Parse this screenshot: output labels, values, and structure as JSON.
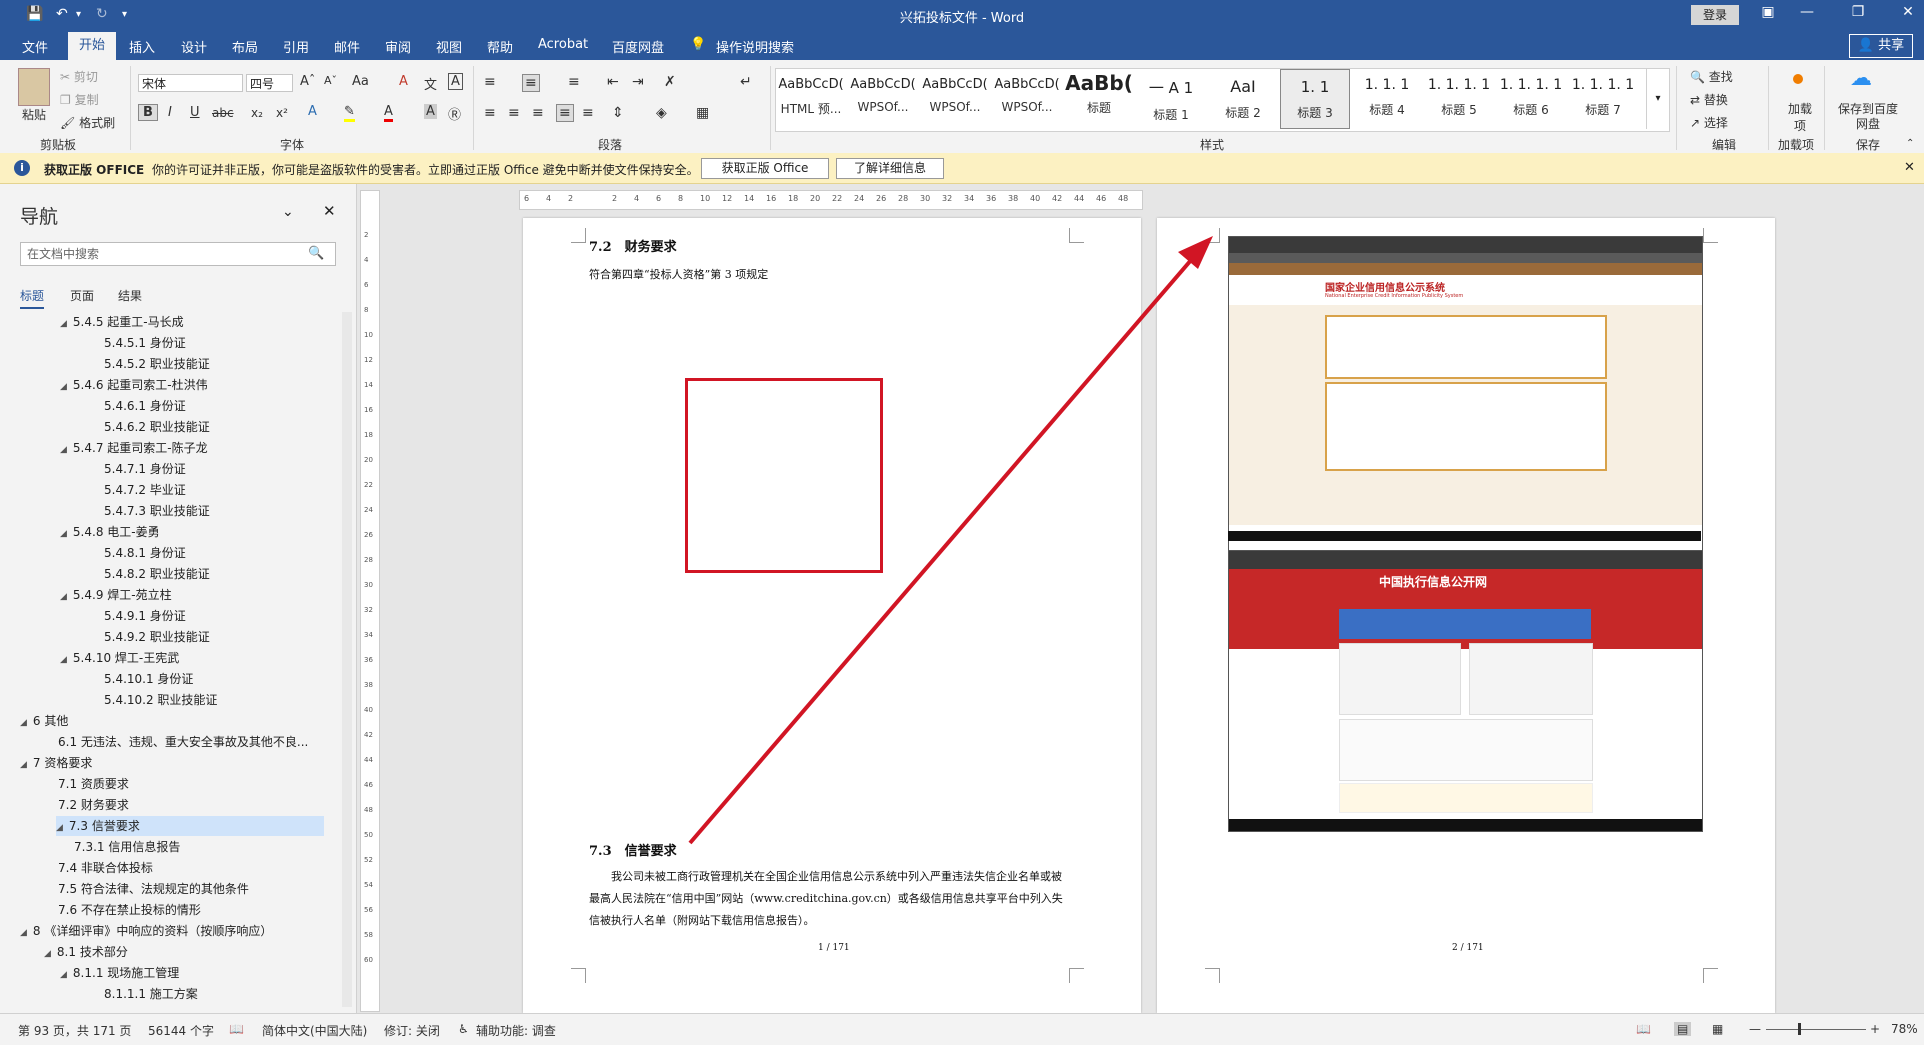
{
  "window": {
    "title": "兴拓投标文件 - Word",
    "login": "登录",
    "share": "共享"
  },
  "tabs": [
    "文件",
    "开始",
    "插入",
    "设计",
    "布局",
    "引用",
    "邮件",
    "审阅",
    "视图",
    "帮助",
    "Acrobat",
    "百度网盘",
    "操作说明搜索"
  ],
  "ribbon": {
    "clipboard": {
      "paste": "粘贴",
      "cut": "剪切",
      "copy": "复制",
      "format_painter": "格式刷",
      "label": "剪贴板"
    },
    "font": {
      "name": "宋体",
      "size": "四号",
      "label": "字体"
    },
    "paragraph": {
      "label": "段落"
    },
    "styles": {
      "label": "样式",
      "items": [
        {
          "preview": "AaBbCcD(",
          "name": "HTML 预..."
        },
        {
          "preview": "AaBbCcD(",
          "name": "WPSOf..."
        },
        {
          "preview": "AaBbCcD(",
          "name": "WPSOf..."
        },
        {
          "preview": "AaBbCcD(",
          "name": "WPSOf..."
        },
        {
          "preview": "AaBb(",
          "name": "标题"
        },
        {
          "preview": "一  A  1",
          "name": "标题 1"
        },
        {
          "preview": "AaI",
          "name": "标题 2"
        },
        {
          "preview": "1. 1",
          "name": "标题 3"
        },
        {
          "preview": "1. 1. 1",
          "name": "标题 4"
        },
        {
          "preview": "1. 1. 1. 1",
          "name": "标题 5"
        },
        {
          "preview": "1. 1. 1. 1",
          "name": "标题 6"
        },
        {
          "preview": "1. 1. 1. 1",
          "name": "标题 7"
        }
      ]
    },
    "editing": {
      "find": "查找",
      "replace": "替换",
      "select": "选择",
      "label": "编辑"
    },
    "addins": {
      "name": "加载项",
      "label": "加载项"
    },
    "save": {
      "name": "保存到百度网盘",
      "label": "保存"
    }
  },
  "infobar": {
    "title": "获取正版 OFFICE",
    "message": "你的许可证并非正版，你可能是盗版软件的受害者。立即通过正版 Office 避免中断并使文件保持安全。",
    "btn_get": "获取正版 Office",
    "btn_more": "了解详细信息"
  },
  "nav": {
    "title": "导航",
    "search_placeholder": "在文档中搜索",
    "tabs": [
      "标题",
      "页面",
      "结果"
    ],
    "tree": [
      {
        "text": "5.4.5 起重工-马长成",
        "level": 3,
        "exp": true
      },
      {
        "text": "5.4.5.1 身份证",
        "level": 4
      },
      {
        "text": "5.4.5.2 职业技能证",
        "level": 4
      },
      {
        "text": "5.4.6 起重司索工-杜洪伟",
        "level": 3,
        "exp": true
      },
      {
        "text": "5.4.6.1 身份证",
        "level": 4
      },
      {
        "text": "5.4.6.2 职业技能证",
        "level": 4
      },
      {
        "text": "5.4.7 起重司索工-陈子龙",
        "level": 3,
        "exp": true
      },
      {
        "text": "5.4.7.1 身份证",
        "level": 4
      },
      {
        "text": "5.4.7.2 毕业证",
        "level": 4
      },
      {
        "text": "5.4.7.3 职业技能证",
        "level": 4
      },
      {
        "text": "5.4.8 电工-姜勇",
        "level": 3,
        "exp": true
      },
      {
        "text": "5.4.8.1 身份证",
        "level": 4
      },
      {
        "text": "5.4.8.2 职业技能证",
        "level": 4
      },
      {
        "text": "5.4.9 焊工-苑立柱",
        "level": 3,
        "exp": true
      },
      {
        "text": "5.4.9.1 身份证",
        "level": 4
      },
      {
        "text": "5.4.9.2 职业技能证",
        "level": 4
      },
      {
        "text": "5.4.10 焊工-王宪武",
        "level": 3,
        "exp": true
      },
      {
        "text": "5.4.10.1 身份证",
        "level": 4
      },
      {
        "text": "5.4.10.2 职业技能证",
        "level": 4
      },
      {
        "text": "6 其他",
        "level": 1,
        "exp": true
      },
      {
        "text": "6.1 无违法、违规、重大安全事故及其他不良...",
        "level": 2
      },
      {
        "text": "7 资格要求",
        "level": 1,
        "exp": true
      },
      {
        "text": "7.1 资质要求",
        "level": 2
      },
      {
        "text": "7.2 财务要求",
        "level": 2
      },
      {
        "text": "7.3 信誉要求",
        "level": 2,
        "exp": true,
        "sel": true
      },
      {
        "text": "7.3.1 信用信息报告",
        "level": 3
      },
      {
        "text": "7.4 非联合体投标",
        "level": 2
      },
      {
        "text": "7.5 符合法律、法规规定的其他条件",
        "level": 2
      },
      {
        "text": "7.6 不存在禁止投标的情形",
        "level": 2
      },
      {
        "text": "8 《详细评审》中响应的资料（按顺序响应）",
        "level": 1,
        "exp": true
      },
      {
        "text": "8.1 技术部分",
        "level": 2,
        "exp": true
      },
      {
        "text": "8.1.1 现场施工管理",
        "level": 3,
        "exp": true
      },
      {
        "text": "8.1.1.1 施工方案",
        "level": 4
      }
    ]
  },
  "ruler_numbers": [
    "6",
    "4",
    "2",
    "",
    "2",
    "4",
    "6",
    "8",
    "10",
    "12",
    "14",
    "16",
    "18",
    "20",
    "22",
    "24",
    "26",
    "28",
    "30",
    "32",
    "34",
    "36",
    "38",
    "40",
    "42",
    "44",
    "46",
    "48"
  ],
  "page1": {
    "h72": "7.2　财务要求",
    "h72_text": "符合第四章“投标人资格”第 3 项规定",
    "h73": "7.3　信誉要求",
    "body": "我公司未被工商行政管理机关在全国企业信用信息公示系统中列入严重违法失信企业名单或被最高人民法院在“信用中国”网站（www.creditchina.gov.cn）或各级信用信息共享平台中列入失信被执行人名单（附网站下载信用信息报告）。",
    "footer": "1 / 171"
  },
  "page2": {
    "site1_title": "国家企业信用信息公示系统",
    "site1_sub": "National Enterprise Credit Information Publicity System",
    "site2_title": "中国执行信息公开网",
    "footer": "2 / 171"
  },
  "status": {
    "page": "第 93 页，共 171 页",
    "words": "56144 个字",
    "lang": "简体中文(中国大陆)",
    "track": "修订: 关闭",
    "access": "辅助功能: 调查",
    "zoom": "78%"
  }
}
